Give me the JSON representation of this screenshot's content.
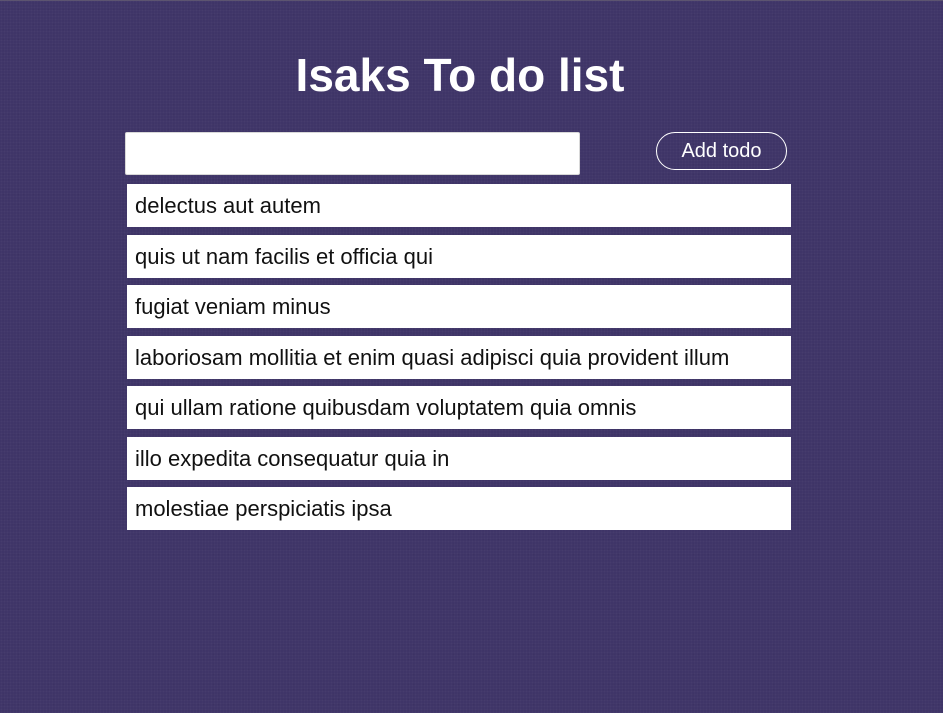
{
  "header": {
    "title": "Isaks To do list"
  },
  "form": {
    "input_value": "",
    "input_placeholder": "",
    "add_button_label": "Add todo"
  },
  "todos": [
    {
      "text": "delectus aut autem"
    },
    {
      "text": "quis ut nam facilis et officia qui"
    },
    {
      "text": "fugiat veniam minus"
    },
    {
      "text": "laboriosam mollitia et enim quasi adipisci quia provident illum"
    },
    {
      "text": "qui ullam ratione quibusdam voluptatem quia omnis"
    },
    {
      "text": "illo expedita consequatur quia in"
    },
    {
      "text": "molestiae perspiciatis ipsa"
    }
  ],
  "colors": {
    "background": "#3f3568",
    "item_background": "#ffffff",
    "text_light": "#ffffff",
    "text_dark": "#111111"
  }
}
